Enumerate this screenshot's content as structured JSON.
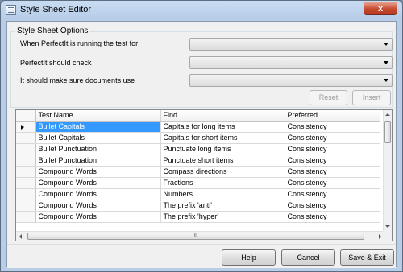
{
  "window": {
    "title": "Style Sheet Editor",
    "close_glyph": "x"
  },
  "options": {
    "group_title": "Style Sheet Options",
    "items": [
      {
        "label": "When PerfectIt is running the test for",
        "value": ""
      },
      {
        "label": "PerfectIt should check",
        "value": ""
      },
      {
        "label": "It should make sure documents use",
        "value": ""
      }
    ],
    "reset_label": "Reset",
    "insert_label": "Insert"
  },
  "grid": {
    "columns": [
      "Test Name",
      "Find",
      "Preferred"
    ],
    "rows": [
      [
        "Bullet Capitals",
        "Capitals for long items",
        "Consistency"
      ],
      [
        "Bullet Capitals",
        "Capitals for short items",
        "Consistency"
      ],
      [
        "Bullet Punctuation",
        "Punctuate long items",
        "Consistency"
      ],
      [
        "Bullet Punctuation",
        "Punctuate short items",
        "Consistency"
      ],
      [
        "Compound Words",
        "Compass directions",
        "Consistency"
      ],
      [
        "Compound Words",
        "Fractions",
        "Consistency"
      ],
      [
        "Compound Words",
        "Numbers",
        "Consistency"
      ],
      [
        "Compound Words",
        "The prefix 'anti'",
        "Consistency"
      ],
      [
        "Compound Words",
        "The prefix 'hyper'",
        "Consistency"
      ]
    ],
    "selected_row": 0,
    "hscroll_grip": "III"
  },
  "footer": {
    "help_label": "Help",
    "cancel_label": "Cancel",
    "save_exit_label": "Save & Exit"
  },
  "colors": {
    "selection": "#3399ff",
    "title_bar": "#b7cde8",
    "close_button": "#c74a2f"
  },
  "icons": [
    "app-icon",
    "close-icon",
    "chevron-down-icon",
    "row-pointer-icon"
  ]
}
